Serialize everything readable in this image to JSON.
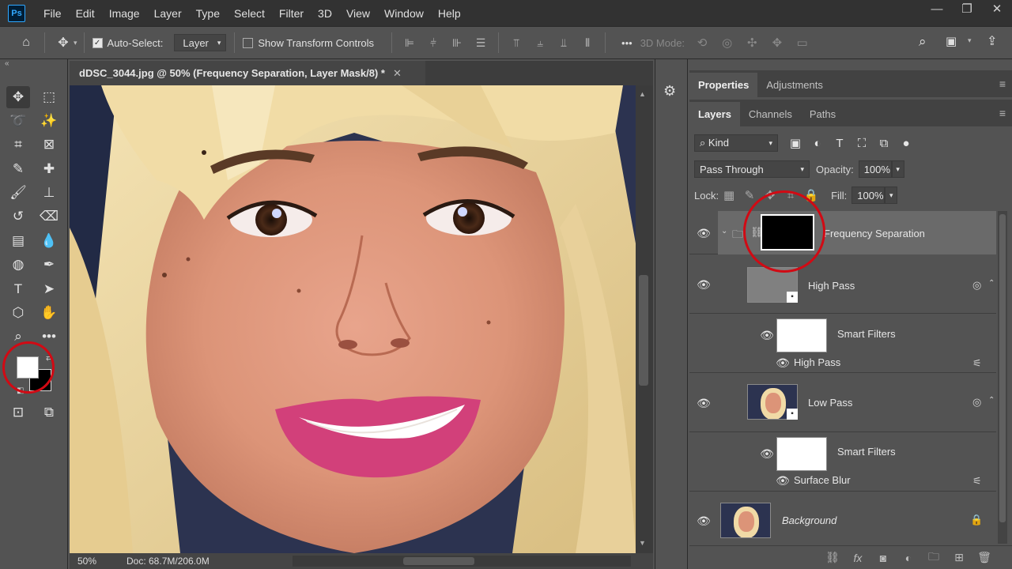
{
  "app": {
    "logo": "Ps"
  },
  "menu": [
    "File",
    "Edit",
    "Image",
    "Layer",
    "Type",
    "Select",
    "Filter",
    "3D",
    "View",
    "Window",
    "Help"
  ],
  "window_controls": {
    "minimize": "—",
    "restore": "❐",
    "close": "✕"
  },
  "options": {
    "home_icon": "⌂",
    "move_icon": "✥",
    "auto_select_label": "Auto-Select:",
    "auto_select_checked": true,
    "auto_select_target": "Layer",
    "show_transform_label": "Show Transform Controls",
    "show_transform_checked": false,
    "more": "•••",
    "mode_3d_label": "3D Mode:"
  },
  "document": {
    "tab_title": "dDSC_3044.jpg @ 50% (Frequency Separation, Layer Mask/8) *",
    "close": "✕",
    "zoom": "50%",
    "doc_size": "Doc: 68.7M/206.0M",
    "status_arrow": "❯"
  },
  "panels": {
    "top_tabs": [
      "Properties",
      "Adjustments"
    ],
    "layer_tabs": [
      "Layers",
      "Channels",
      "Paths"
    ],
    "kind_filter": "Kind",
    "blend_mode": "Pass Through",
    "opacity_label": "Opacity:",
    "opacity_value": "100%",
    "lock_label": "Lock:",
    "fill_label": "Fill:",
    "fill_value": "100%"
  },
  "layers": [
    {
      "name": "Frequency Separation",
      "type": "group"
    },
    {
      "name": "High Pass",
      "type": "smart"
    },
    {
      "name": "Smart Filters",
      "type": "filters"
    },
    {
      "name": "High Pass",
      "type": "filter"
    },
    {
      "name": "Low Pass",
      "type": "smart"
    },
    {
      "name": "Smart Filters",
      "type": "filters"
    },
    {
      "name": "Surface Blur",
      "type": "filter"
    },
    {
      "name": "Background",
      "type": "background"
    }
  ],
  "colors": {
    "accent_circle": "#d10a14",
    "foreground": "#ffffff",
    "background": "#000000",
    "panel_bg": "#535353"
  }
}
